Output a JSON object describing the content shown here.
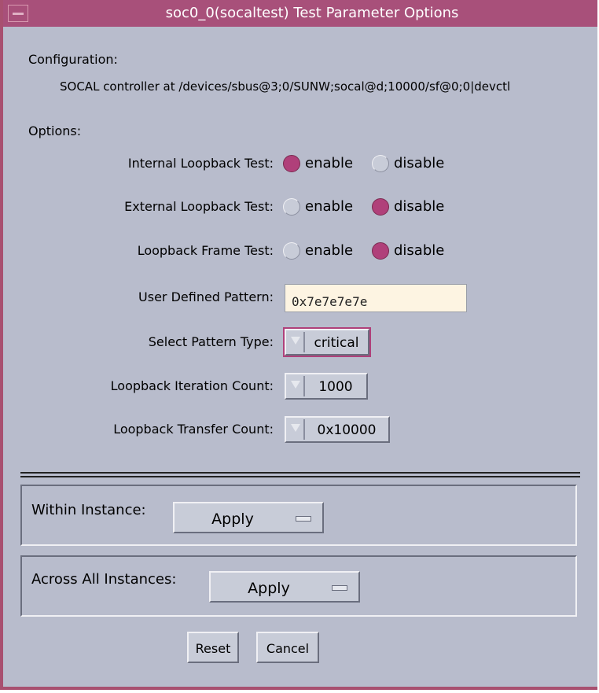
{
  "window": {
    "title": "soc0_0(socaltest) Test Parameter Options"
  },
  "configuration": {
    "heading": "Configuration:",
    "text": "SOCAL controller at /devices/sbus@3;0/SUNW;socal@d;10000/sf@0;0|devctl"
  },
  "options": {
    "heading": "Options:",
    "internal_loopback": {
      "label": "Internal Loopback Test:",
      "selected": "enable",
      "enable_label": "enable",
      "disable_label": "disable"
    },
    "external_loopback": {
      "label": "External Loopback Test:",
      "selected": "disable",
      "enable_label": "enable",
      "disable_label": "disable"
    },
    "loopback_frame": {
      "label": "Loopback Frame Test:",
      "selected": "disable",
      "enable_label": "enable",
      "disable_label": "disable"
    },
    "user_pattern": {
      "label": "User Defined Pattern:",
      "value": "0x7e7e7e7e"
    },
    "pattern_type": {
      "label": "Select Pattern Type:",
      "value": "critical"
    },
    "iteration_count": {
      "label": "Loopback Iteration Count:",
      "value": "1000"
    },
    "transfer_count": {
      "label": "Loopback Transfer Count:",
      "value": "0x10000"
    }
  },
  "within_instance": {
    "label": "Within Instance:",
    "button": "Apply"
  },
  "across_instances": {
    "label": "Across All Instances:",
    "button": "Apply"
  },
  "buttons": {
    "reset": "Reset",
    "cancel": "Cancel"
  },
  "colors": {
    "accent": "#a8507a",
    "background": "#b8bccc",
    "radio_on": "#b0407a",
    "input_bg": "#fdf4e2"
  }
}
